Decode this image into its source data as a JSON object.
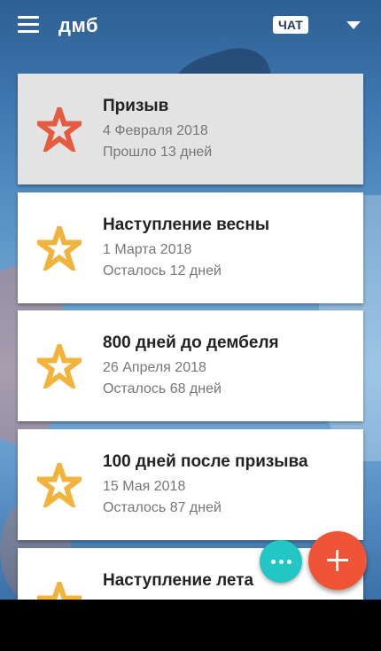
{
  "app": {
    "title": "дмб",
    "chat_label": "ЧАТ"
  },
  "colors": {
    "active_star": "#e45b3f",
    "star": "#f1b33c",
    "fab_chat": "#22c6c4",
    "fab_add": "#ef5436"
  },
  "events": [
    {
      "title": "Призыв",
      "date": "4 Февраля 2018",
      "status": "Прошло 13 дней",
      "active": true
    },
    {
      "title": "Наступление весны",
      "date": "1 Марта 2018",
      "status": "Осталось 12 дней",
      "active": false
    },
    {
      "title": "800 дней до дембеля",
      "date": "26 Апреля 2018",
      "status": "Осталось 68 дней",
      "active": false
    },
    {
      "title": "100 дней после призыва",
      "date": "15 Мая 2018",
      "status": "Осталось 87 дней",
      "active": false
    },
    {
      "title": "Наступление лета",
      "date": "",
      "status": "",
      "active": false
    }
  ],
  "icons": {
    "menu": "hamburger-menu-icon",
    "dropdown": "chevron-down-icon",
    "star": "star-icon",
    "chat_fab": "more-dots-icon",
    "add_fab": "plus-icon"
  }
}
